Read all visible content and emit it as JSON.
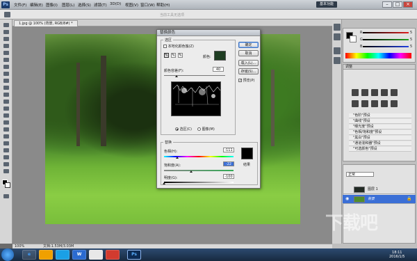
{
  "app": {
    "logo": "Ps",
    "menu": [
      "文件(F)",
      "编辑(E)",
      "图像(I)",
      "图层(L)",
      "选择(S)",
      "滤镜(T)",
      "3D(D)",
      "视图(V)",
      "窗口(W)",
      "帮助(H)"
    ],
    "workspace": "基本功能",
    "window_buttons": [
      "–",
      "□",
      "×"
    ],
    "options_hint": "当前工具无选项",
    "doc_tab": "1.jpg @ 100% (背景, RGB/8#) *",
    "zoom": "100%",
    "doc_info": "文档:1.53M/3.03M"
  },
  "dialog": {
    "title": "替换颜色",
    "selection_label": "选区",
    "localized_label": "本地化颜色簇(Z)",
    "localized_checked": false,
    "color_label": "颜色:",
    "sample_color": "#1e3d22",
    "tolerance_label": "颜色容差(F):",
    "tolerance_value": "40",
    "tolerance_fraction": 0.2,
    "radio_selection": "选区(C)",
    "radio_image": "图像(M)",
    "replace_label": "替换",
    "hue_label": "色相(H):",
    "hue_value": "-111",
    "hue_fraction": 0.19,
    "sat_label": "饱和度(A):",
    "sat_value": "-22",
    "sat_fraction": 0.39,
    "light_label": "明度(G):",
    "light_value": "-100",
    "light_fraction": 0.0,
    "result_label": "结果",
    "result_color": "#000000",
    "buttons": {
      "ok": "确定",
      "cancel": "取消",
      "load": "载入(L)...",
      "save": "存储(S)..."
    },
    "preview_label": "预览(P)",
    "preview_checked": true,
    "eyedroppers": [
      "eyedropper",
      "eyedropper-plus",
      "eyedropper-minus"
    ]
  },
  "panels": {
    "color": {
      "sliders": [
        {
          "label": "R",
          "value": "5",
          "color": "#e02020"
        },
        {
          "label": "G",
          "value": "5",
          "color": "#20a020"
        },
        {
          "label": "B",
          "value": "5",
          "color": "#2040e0"
        }
      ]
    },
    "adjustments_title": "调整",
    "presets": [
      "\"色阶\"预设",
      "\"曲线\"预设",
      "\"曝光度\"预设",
      "\"色相/饱和度\"预设",
      "\"黑白\"预设",
      "\"通道混和器\"预设",
      "\"可选颜色\"预设"
    ],
    "layers_mode": "正常",
    "layers": [
      {
        "name": "图层 1",
        "visible": false,
        "thumb": "#222a24"
      },
      {
        "name": "背景",
        "visible": true,
        "thumb": "#4f8d2d",
        "selected": true
      }
    ]
  },
  "taskbar": {
    "apps": [
      "e",
      "",
      "",
      "W",
      "",
      "",
      "Ps"
    ],
    "time": "18:11",
    "date": "2016/1/5"
  },
  "watermark": "下载吧"
}
